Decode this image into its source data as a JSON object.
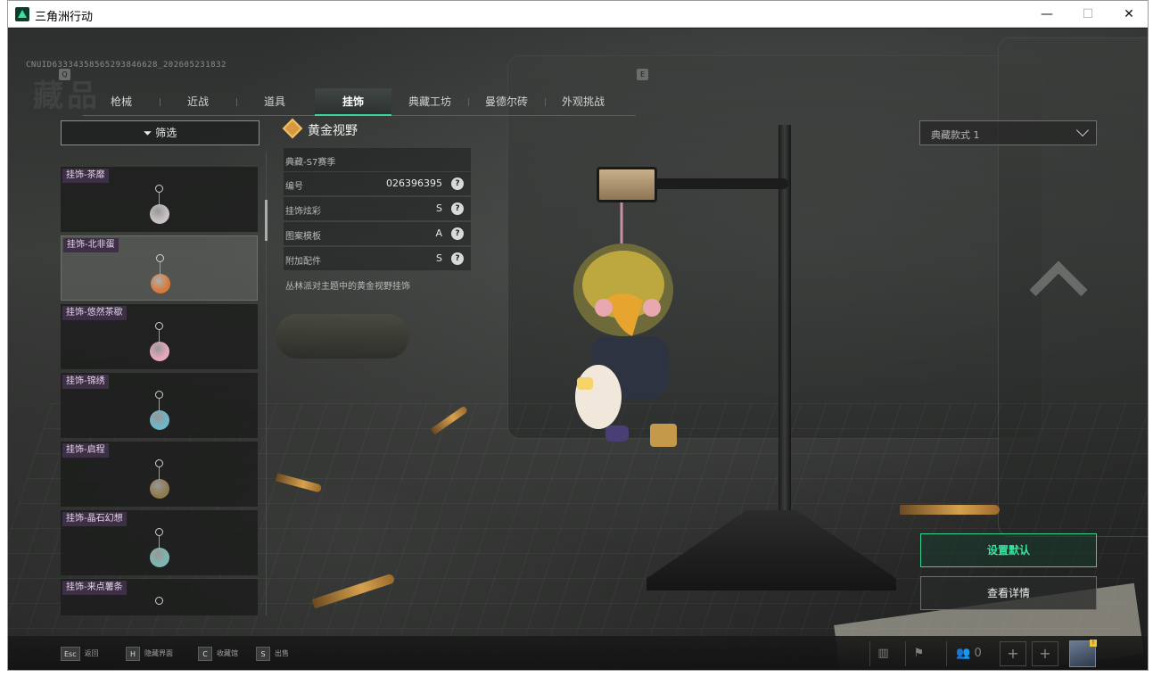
{
  "window": {
    "title": "三角洲行动",
    "controls": {
      "minimize": "—",
      "maximize": "☐",
      "close": "✕"
    }
  },
  "uid": "CNUID63334358565293846628_202605231832",
  "page_title": "藏品",
  "tabs": {
    "prev_key": "Q",
    "next_key": "E",
    "items": [
      "枪械",
      "近战",
      "道具",
      "挂饰",
      "典藏工坊",
      "曼德尔砖",
      "外观挑战"
    ],
    "active_index": 3
  },
  "filter": {
    "label": "筛选"
  },
  "list": {
    "items": [
      {
        "label": "挂饰-茶靡",
        "color": "#c9c2c4"
      },
      {
        "label": "挂饰-北非蛋",
        "color": "#d87a3c"
      },
      {
        "label": "挂饰-悠然茶歇",
        "color": "#e8a8c0"
      },
      {
        "label": "挂饰-锦绣",
        "color": "#6fb6c9"
      },
      {
        "label": "挂饰-启程",
        "color": "#8f7a4e"
      },
      {
        "label": "挂饰-晶石幻想",
        "color": "#7cb8b3"
      },
      {
        "label": "挂饰-来点薯条",
        "color": "#d9b34a"
      }
    ],
    "selected_index": 1
  },
  "detail": {
    "name": "黄金视野",
    "series": "典藏-S7赛季",
    "rows": [
      {
        "key": "编号",
        "value": "026396395"
      },
      {
        "key": "挂饰炫彩",
        "value": "S"
      },
      {
        "key": "图案模板",
        "value": "A"
      },
      {
        "key": "附加配件",
        "value": "S"
      }
    ],
    "help_glyph": "?",
    "description": "丛林派对主题中的黄金视野挂饰"
  },
  "variant": {
    "selected": "典藏款式 1"
  },
  "actions": {
    "set_default": "设置默认",
    "view_detail": "查看详情"
  },
  "bottom": {
    "hints": [
      {
        "key": "Esc",
        "label": "返回"
      },
      {
        "key": "H",
        "label": "隐藏界面"
      },
      {
        "key": "C",
        "label": "收藏馆"
      },
      {
        "key": "S",
        "label": "出售"
      }
    ],
    "friends_count": "0",
    "plus_glyph": "+",
    "avatar_badge": "!"
  },
  "colors": {
    "accent": "#38d49a",
    "label_bg": "#3d2f45",
    "gold": "#d69a3c"
  }
}
